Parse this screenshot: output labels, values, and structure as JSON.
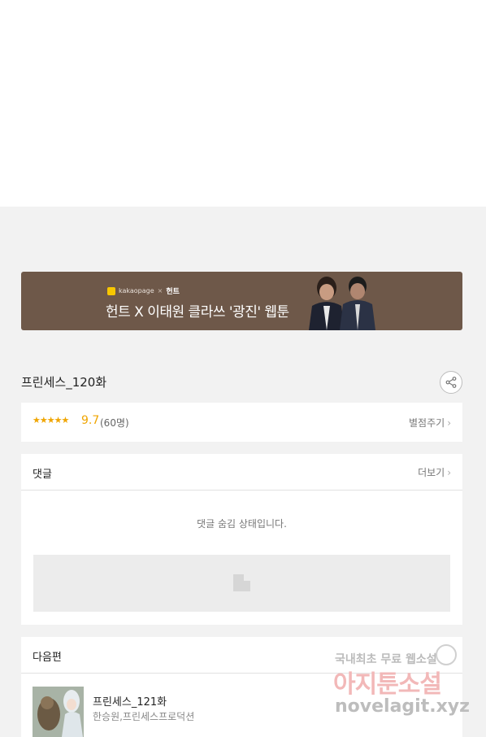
{
  "banner": {
    "brand": "kakaopage",
    "brand_sep": "×",
    "partner": "헌트",
    "title": "헌트 X 이태원 클라쓰 '광진' 웹툰"
  },
  "episode": {
    "title": "프린세스_120화"
  },
  "rating": {
    "stars": "★★★★★",
    "score": "9.7",
    "count": "(60명)",
    "rate_link": "별점주기",
    "chevron": "›"
  },
  "comments": {
    "title": "댓글",
    "more_link": "더보기",
    "chevron": "›",
    "hidden_message": "댓글 숨김 상태입니다."
  },
  "next": {
    "title": "다음편",
    "episode": "프린세스_121화",
    "meta": "한승원,프린세스프로덕션"
  },
  "watermark": {
    "line1": "국내최초 무료 웹소설",
    "line2": "아지툰소설",
    "line3": "novelagit.xyz"
  },
  "colors": {
    "banner_bg": "#6e5849",
    "star": "#f0a500",
    "page_bg": "#f2f2f2"
  }
}
